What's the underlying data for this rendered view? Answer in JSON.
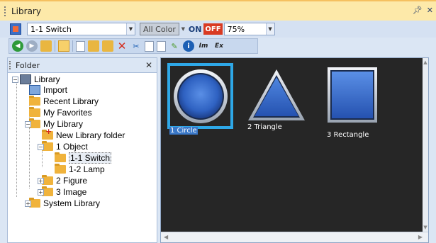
{
  "window": {
    "title": "Library",
    "pin_icon": "pin-icon",
    "close_icon": "close-icon"
  },
  "toolbar1": {
    "library_select": {
      "value": "1-1 Switch"
    },
    "color_select": {
      "value": "All Color"
    },
    "on_label": "ON",
    "off_label": "OFF",
    "zoom_select": {
      "value": "75%"
    }
  },
  "toolbar2": {
    "buttons": [
      {
        "name": "back-icon"
      },
      {
        "name": "forward-icon"
      },
      {
        "name": "up-folder-icon"
      },
      {
        "name": "view-mode-icon"
      },
      {
        "name": "new-folder-icon"
      },
      {
        "name": "copy-to-icon"
      },
      {
        "name": "add-folder-icon"
      },
      {
        "name": "delete-icon"
      },
      {
        "name": "cut-icon"
      },
      {
        "name": "copy-icon"
      },
      {
        "name": "paste-icon"
      },
      {
        "name": "edit-icon"
      },
      {
        "name": "info-icon"
      },
      {
        "name": "import-icon"
      },
      {
        "name": "export-icon"
      }
    ],
    "import_label": "Im",
    "export_label": "Ex"
  },
  "folder_panel": {
    "title": "Folder",
    "tree": [
      {
        "label": "Library",
        "expander": "−"
      },
      {
        "label": "Import"
      },
      {
        "label": "Recent Library"
      },
      {
        "label": "My Favorites"
      },
      {
        "label": "My Library",
        "expander": "−"
      },
      {
        "label": "New Library folder"
      },
      {
        "label": "1 Object",
        "expander": "−"
      },
      {
        "label": "1-1 Switch",
        "selected": true
      },
      {
        "label": "1-2 Lamp"
      },
      {
        "label": "2 Figure",
        "expander": "+"
      },
      {
        "label": "3 Image",
        "expander": "+"
      },
      {
        "label": "System Library",
        "expander": "+"
      }
    ]
  },
  "library_view": {
    "items": [
      {
        "label": "1 Circle",
        "shape": "circle",
        "selected": true
      },
      {
        "label": "2 Triangle",
        "shape": "triangle"
      },
      {
        "label": "3 Rectangle",
        "shape": "rectangle"
      }
    ]
  },
  "colors": {
    "title_bg": "#fde9a9",
    "panel_bg": "#dbe6f4",
    "view_bg": "#262626",
    "selection": "#2ea8e8",
    "shape_blue": "#3a6fd0"
  }
}
